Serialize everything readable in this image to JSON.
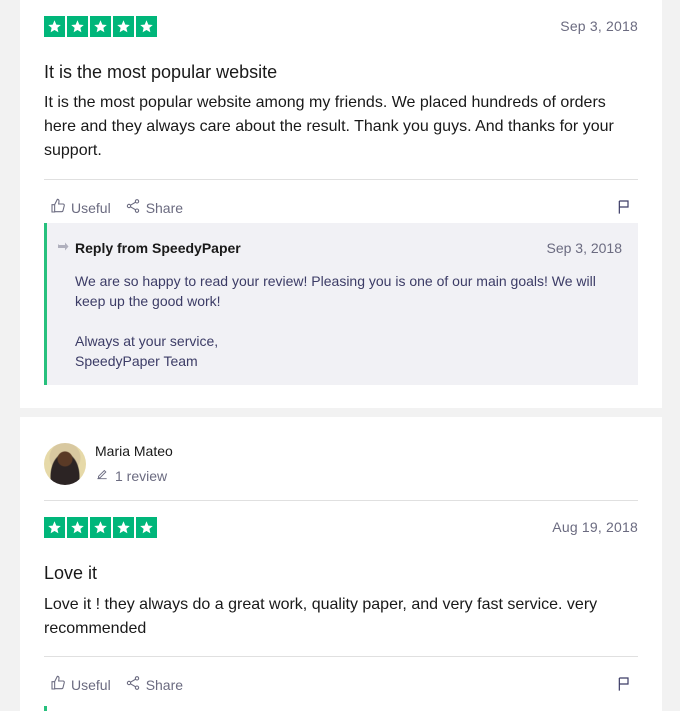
{
  "review1": {
    "rating": 5,
    "date": "Sep 3, 2018",
    "title": "It is the most popular website",
    "body": "It is the most popular website among my friends. We placed hundreds of orders here and they always care about the result. Thank you guys. And thanks for your support.",
    "useful_label": "Useful",
    "share_label": "Share",
    "reply": {
      "header": "Reply from SpeedyPaper",
      "date": "Sep 3, 2018",
      "line1": "We are so happy to read your review! Pleasing you is one of our main goals! We will keep up the good work!",
      "line2": "Always at your service,",
      "line3": "SpeedyPaper Team"
    }
  },
  "review2": {
    "author": "Maria Mateo",
    "review_count": "1 review",
    "rating": 5,
    "date": "Aug 19, 2018",
    "title": "Love it",
    "body": "Love it ! they always do a great work, quality paper, and very fast service. very recommended",
    "useful_label": "Useful",
    "share_label": "Share"
  },
  "colors": {
    "star_green": "#00b67a",
    "reply_border": "#27c07d",
    "reply_bg": "#f1f1f5",
    "muted_text": "#6b6b80"
  },
  "icons": [
    "star-icon",
    "thumbs-up-icon",
    "share-icon",
    "flag-icon",
    "reply-arrow-icon",
    "pencil-icon"
  ]
}
